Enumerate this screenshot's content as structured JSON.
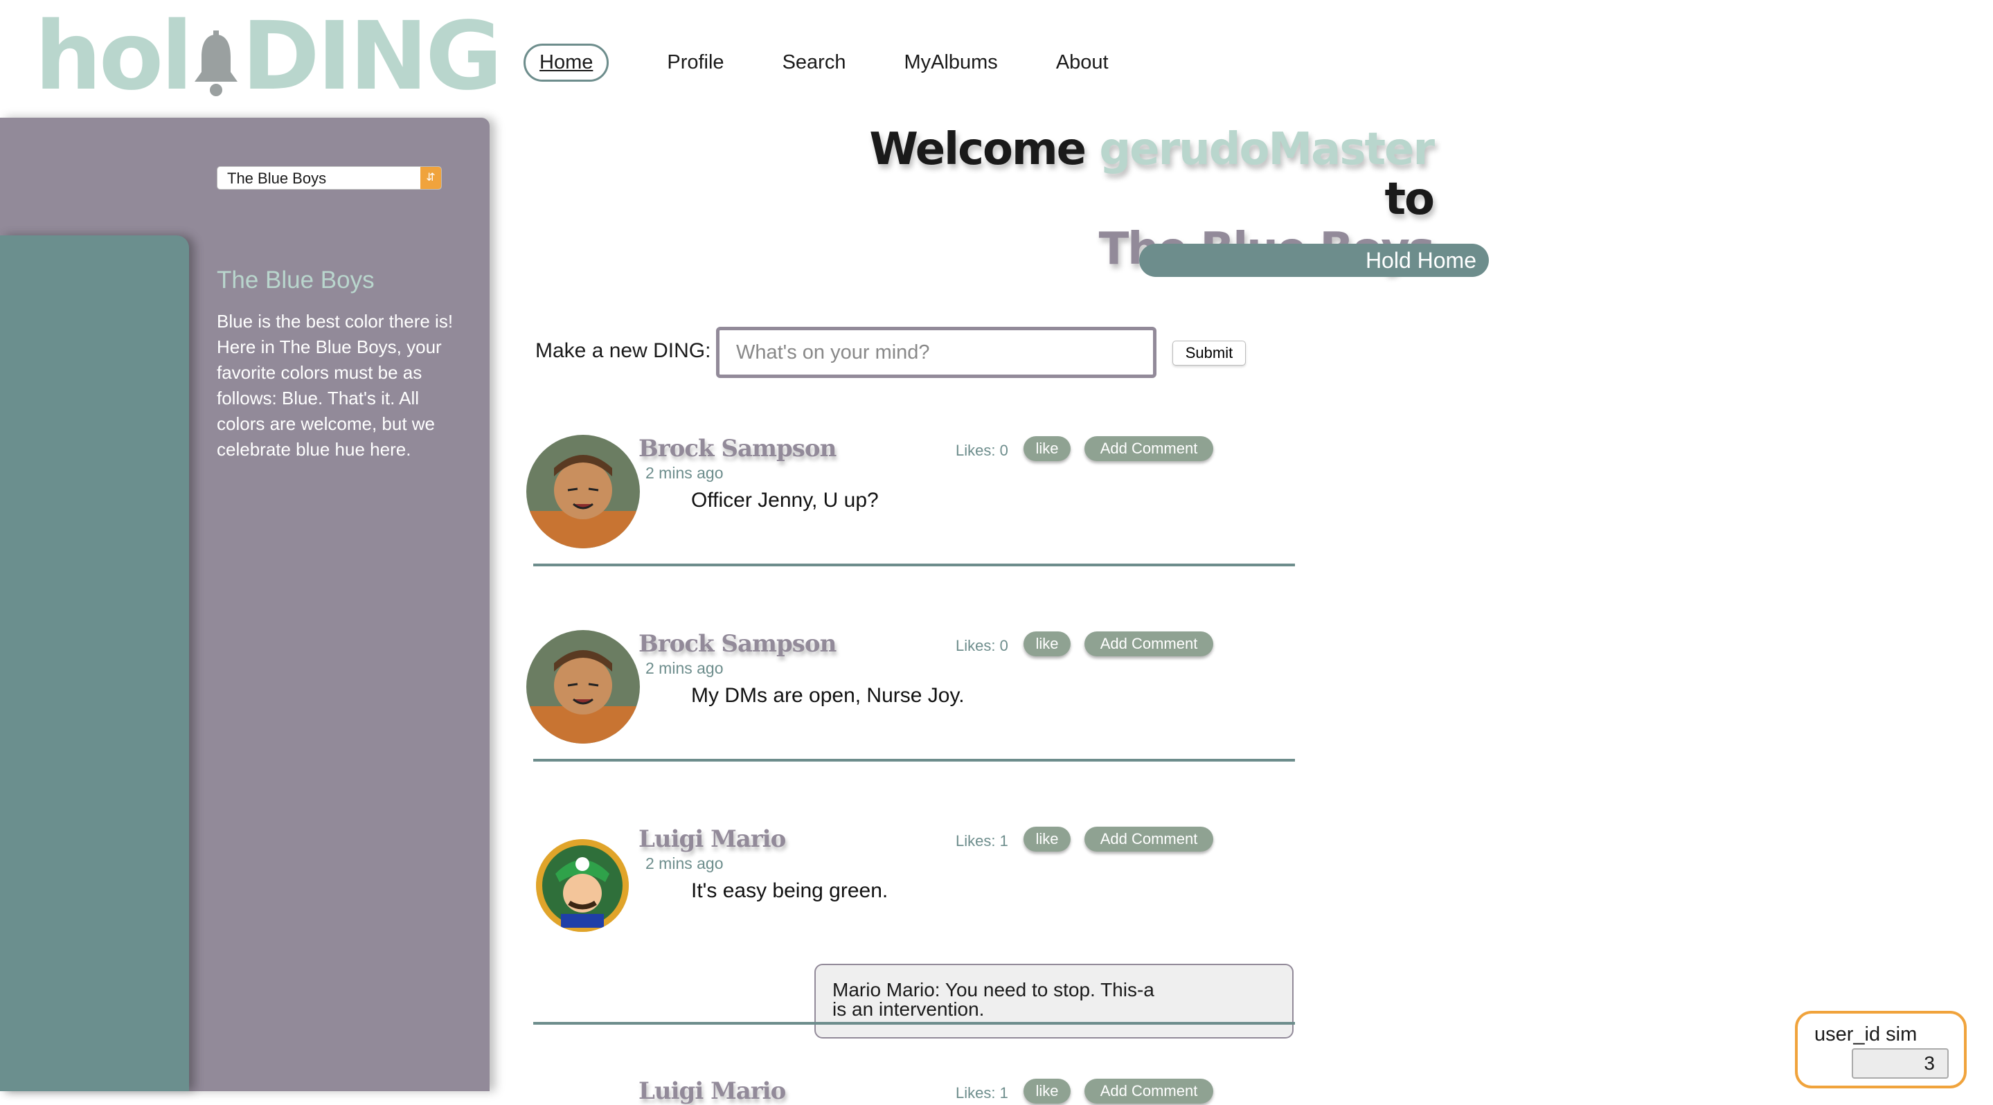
{
  "logo": {
    "text_left": "hol",
    "text_right": "DING"
  },
  "nav": {
    "items": [
      {
        "label": "Home",
        "active": true
      },
      {
        "label": "Profile"
      },
      {
        "label": "Search"
      },
      {
        "label": "MyAlbums"
      },
      {
        "label": "About"
      }
    ]
  },
  "sidebar": {
    "group_select": "The Blue Boys",
    "group_title": "The Blue Boys",
    "group_description": "Blue is the best color there is! Here in The Blue Boys, your favorite colors must be as follows: Blue. That's it. All colors are welcome, but we celebrate blue hue here."
  },
  "welcome": {
    "prefix": "Welcome",
    "username": "gerudoMaster",
    "to": "to",
    "group": "The Blue Boys"
  },
  "hold_home_label": "Hold Home",
  "new_ding": {
    "label": "Make a new DING:",
    "placeholder": "What's on your mind?",
    "submit_label": "Submit"
  },
  "posts": [
    {
      "name": "Brock Sampson",
      "time": "2 mins ago",
      "text": "Officer Jenny, U up?",
      "likes": "Likes: 0",
      "like_label": "like",
      "comment_label": "Add Comment"
    },
    {
      "name": "Brock Sampson",
      "time": "2 mins ago",
      "text": "My DMs are open, Nurse Joy.",
      "likes": "Likes: 0",
      "like_label": "like",
      "comment_label": "Add Comment"
    },
    {
      "name": "Luigi Mario",
      "time": "2 mins ago",
      "text": "It's easy being green.",
      "likes": "Likes: 1",
      "like_label": "like",
      "comment_label": "Add Comment",
      "comment": "Mario Mario: You need to stop. This-a is an intervention."
    },
    {
      "name": "Luigi Mario",
      "time": "",
      "text": "",
      "likes": "Likes: 1",
      "like_label": "like",
      "comment_label": "Add Comment"
    }
  ],
  "user_sim": {
    "label": "user_id sim",
    "value": "3"
  },
  "colors": {
    "accent_teal": "#6d8d8c",
    "mint": "#b9d6cd",
    "mauve": "#928a99",
    "orange": "#f0a33c"
  }
}
